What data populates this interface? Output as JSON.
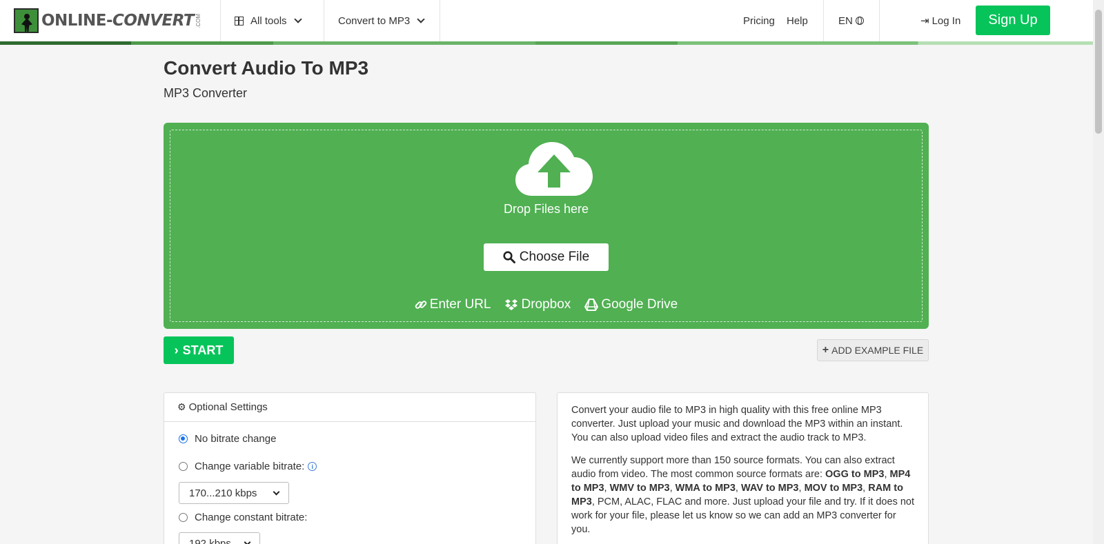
{
  "header": {
    "logo_text_a": "ONLINE-",
    "logo_text_b": "CONVERT",
    "logo_com": ".COM",
    "nav": {
      "all_tools": "All tools",
      "convert_to": "Convert to MP3",
      "pricing": "Pricing",
      "help": "Help",
      "language": "EN",
      "login": "Log In",
      "signup": "Sign Up"
    }
  },
  "page": {
    "title": "Convert Audio To MP3",
    "subtitle": "MP3 Converter"
  },
  "upload": {
    "drop_text": "Drop Files here",
    "choose_file": "Choose File",
    "sources": {
      "url": "Enter URL",
      "dropbox": "Dropbox",
      "gdrive": "Google Drive"
    }
  },
  "actions": {
    "start": "START",
    "add_example": "ADD EXAMPLE FILE"
  },
  "settings": {
    "heading": "Optional Settings",
    "options": {
      "no_change": "No bitrate change",
      "variable": "Change variable bitrate:",
      "constant": "Change constant bitrate:"
    },
    "variable_value": "170...210 kbps",
    "constant_value": "192 kbps",
    "selected_option": "no_change"
  },
  "description": {
    "p1": "Convert your audio file to MP3 in high quality with this free online MP3 converter. Just upload your music and download the MP3 within an instant. You can also upload video files and extract the audio track to MP3.",
    "p2_intro": "We currently support more than 150 source formats. You can also extract audio from video. The most common source formats are: ",
    "p2_formats": [
      "OGG to MP3",
      "MP4 to MP3",
      "WMV to MP3",
      "WMA to MP3",
      "WAV to MP3",
      "MOV to MP3",
      "RAM to MP3"
    ],
    "p2_sep": ", ",
    "p2_tail": ", PCM, ALAC, FLAC and more. Just upload your file and try. If it does not work for your file, please let us know so we can add an MP3 converter for you."
  },
  "colors": {
    "brand_green": "#50b052",
    "cta_green": "#07c45a"
  }
}
